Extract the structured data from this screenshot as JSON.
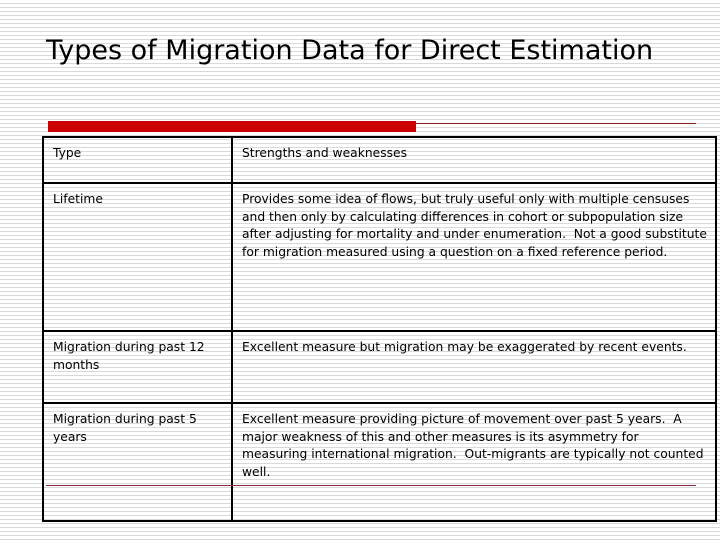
{
  "slide": {
    "title": "Types of Migration Data for Direct Estimation",
    "accent_color_bar": "#cc0000",
    "accent_color_rule": "#8b1a1a",
    "stray_rule_color": "#8b2b40",
    "background_color": "#ffffff",
    "text_color": "#000000"
  },
  "table": {
    "columns": [
      {
        "key": "type",
        "header": "Type"
      },
      {
        "key": "strengths",
        "header": "Strengths and weaknesses"
      }
    ],
    "rows": [
      {
        "type": "Lifetime",
        "strengths": "Provides some idea of flows, but truly useful only with multiple censuses and then only by calculating differences in cohort or subpopulation size after adjusting for mortality and under enumeration.  Not a good substitute for migration measured using a question on a fixed reference period."
      },
      {
        "type": "Migration during past 12 months",
        "strengths": "Excellent measure but migration may be exaggerated by recent events."
      },
      {
        "type": "Migration during past 5 years",
        "strengths": "Excellent measure providing picture of movement over past 5 years.  A major weakness of this and other measures is its asymmetry for measuring international migration.  Out-migrants are typically not counted well."
      }
    ]
  }
}
